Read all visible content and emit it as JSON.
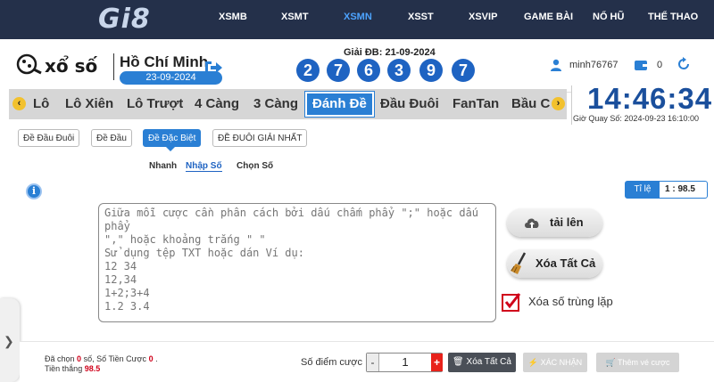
{
  "nav": {
    "logo": "Gi8",
    "items": [
      "XSMB",
      "XSMT",
      "XSMN",
      "XSST",
      "XSVIP",
      "GAME BÀI",
      "NỔ HŨ",
      "THỂ THAO"
    ],
    "active": "XSMN"
  },
  "header": {
    "brand": "xổ số",
    "city": "Hồ Chí Minh",
    "date": "23-09-2024",
    "prize_label": "Giải ĐB: 21-09-2024",
    "digits": [
      "2",
      "7",
      "6",
      "3",
      "9",
      "7"
    ],
    "username": "minh76767",
    "balance": "0"
  },
  "tabs": {
    "items": [
      "Lô",
      "Lô Xiên",
      "Lô Trượt",
      "4 Càng",
      "3 Càng",
      "Đánh Đề",
      "Đầu Đuôi",
      "FanTan",
      "Bầu C"
    ],
    "active": "Đánh Đề"
  },
  "clock": {
    "time": "14:46:34",
    "draw_time": "Giờ Quay Số: 2024-09-23 16:10:00"
  },
  "subtabs": [
    "Đề Đầu Đuôi",
    "Đề Đầu",
    "Đề Đặc Biệt",
    "ĐỀ ĐUÔI GIẢI NHẤT"
  ],
  "modes": [
    "Nhanh",
    "Nhập Số",
    "Chọn Số"
  ],
  "rate": {
    "label": "Tỉ lệ",
    "value": "1 : 98.5"
  },
  "input": {
    "placeholder": "Giữa mỗi cược cần phân cách bởi dấu chấm phẩy \";\" hoặc dấu phẩy\n\",\" hoặc khoảng trắng \" \"\nSử dụng tệp TXT hoặc dán Ví dụ:\n12 34\n12,34\n1+2;3+4\n1.2 3.4"
  },
  "actions": {
    "upload": "tải lên",
    "clear_all": "Xóa Tất Cả",
    "dedupe": "Xóa số trùng lặp"
  },
  "footer": {
    "selected_label": "Đã chọn",
    "selected_count": "0",
    "selected_unit": "số,",
    "stake_total_label": "Số Tiền Cược",
    "stake_total": "0",
    "stake_total_suffix": ".",
    "win_label": "Tiền thắng",
    "win_value": "98.5",
    "points_label": "Số điểm cược",
    "points_value": "1",
    "clear_btn": "Xóa Tất Cả",
    "confirm_btn": "XÁC NHẬN",
    "add_ticket_btn": "Thêm vé cược"
  },
  "colors": {
    "nav_bg": "#24304a",
    "accent": "#2a7fd4",
    "digit": "#1e63c2",
    "danger": "#e8221b"
  }
}
